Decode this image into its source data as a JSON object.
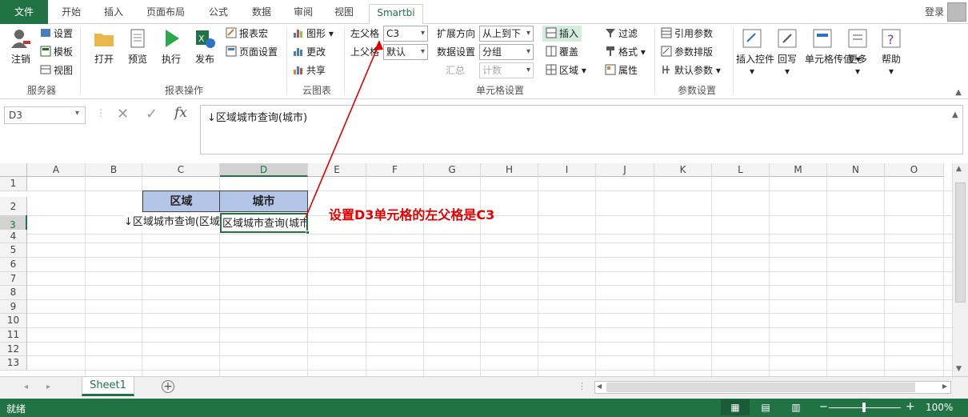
{
  "ribbon_tabs": {
    "file": "文件",
    "items": [
      "开始",
      "插入",
      "页面布局",
      "公式",
      "数据",
      "审阅",
      "视图"
    ],
    "active": "Smartbi",
    "login": "登录"
  },
  "groups": {
    "server": {
      "label": "服务器",
      "logout": "注销",
      "settings": "设置",
      "template": "模板",
      "view": "视图"
    },
    "report_ops": {
      "label": "报表操作",
      "open": "打开",
      "preview": "预览",
      "execute": "执行",
      "publish": "发布",
      "report_macro": "报表宏",
      "page_setup": "页面设置"
    },
    "cloud_chart": {
      "label": "云图表",
      "chart": "图形",
      "change": "更改",
      "share": "共享"
    },
    "cell_settings": {
      "label": "单元格设置",
      "left_parent_label": "左父格",
      "left_parent_value": "C3",
      "top_parent_label": "上父格",
      "top_parent_value": "默认",
      "expand_dir_label": "扩展方向",
      "expand_dir_value": "从上到下",
      "data_setting_label": "数据设置",
      "data_setting_value": "分组",
      "summary_label": "汇总",
      "summary_value": "计数",
      "insert": "插入",
      "cover": "覆盖",
      "region": "区域",
      "filter": "过滤",
      "format": "格式",
      "property": "属性"
    },
    "param_settings": {
      "label": "参数设置",
      "ref_param": "引用参数",
      "param_layout": "参数排版",
      "default_param": "默认参数"
    },
    "insert_control": "插入控件",
    "write_back": "回写",
    "cell_pass": "单元格传值",
    "more": "更多",
    "help": "帮助"
  },
  "formula_bar": {
    "name_box": "D3",
    "content": "↓区域城市查询(城市)"
  },
  "sheet": {
    "columns": [
      "A",
      "B",
      "C",
      "D",
      "E",
      "F",
      "G",
      "H",
      "I",
      "J",
      "K",
      "L",
      "M",
      "N",
      "O"
    ],
    "rows": [
      "1",
      "2",
      "3",
      "4",
      "5",
      "6",
      "7",
      "8",
      "9",
      "10",
      "11",
      "12",
      "13"
    ],
    "header_c2": "区域",
    "header_d2": "城市",
    "c3": "↓区域城市查询(区域)",
    "d3": "区域城市查询(城市)",
    "annotation": "设置D3单元格的左父格是C3"
  },
  "sheet_tabs": {
    "active": "Sheet1"
  },
  "status": {
    "ready": "就绪",
    "zoom": "100%"
  },
  "colors": {
    "accent": "#217346",
    "header_fill": "#b4c6e7",
    "annotation": "#e00000"
  }
}
